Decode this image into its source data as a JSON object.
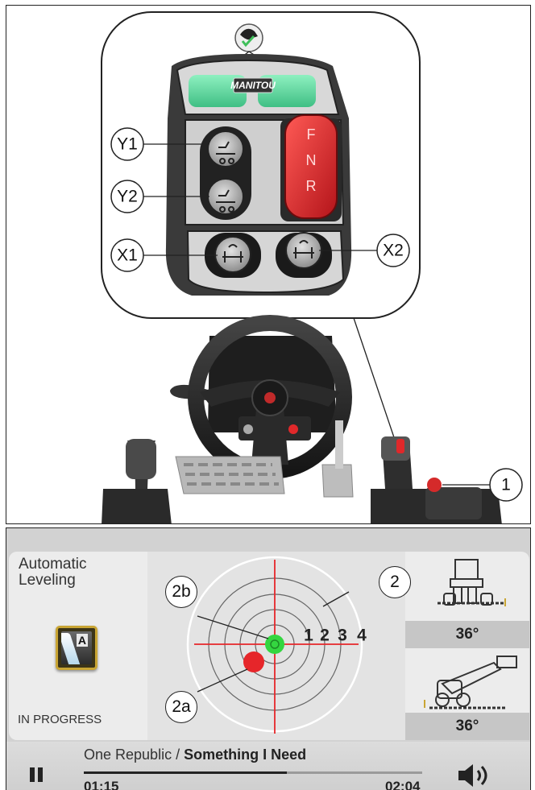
{
  "figure": {
    "brand_label": "MANITOU",
    "shuttle_letters": [
      "F",
      "N",
      "R"
    ],
    "callouts": {
      "y1": "Y1",
      "y2": "Y2",
      "x1": "X1",
      "x2": "X2",
      "one": "1"
    }
  },
  "screen": {
    "mode_title": "Automatic\nLeveling",
    "mode_status": "IN PROGRESS",
    "mode_button_letter": "A",
    "target_rings": [
      "1",
      "2",
      "3",
      "4"
    ],
    "callouts": {
      "two": "2",
      "two_a": "2a",
      "two_b": "2b"
    },
    "angle_top": "36°",
    "angle_bottom": "36°",
    "player": {
      "artist": "One Republic / ",
      "title": "Something I Need",
      "current_time": "01:15",
      "total_time": "02:04",
      "progress": 0.6
    }
  },
  "colors": {
    "shuttle_red": "#e0282a",
    "mode_green": "#5ed49a",
    "target_red": "#e6262a",
    "target_green": "#34d640",
    "button_gold": "#c9a534"
  }
}
